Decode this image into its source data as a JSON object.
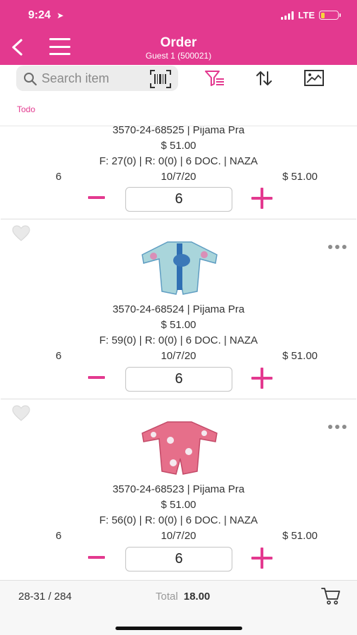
{
  "status_bar": {
    "time": "9:24",
    "network": "LTE",
    "battery_color": "#f7d43b"
  },
  "header": {
    "title": "Order",
    "subtitle": "Guest 1 (500021)",
    "background": "#e3398f"
  },
  "toolbar": {
    "search_placeholder": "Search item",
    "icons": [
      "search-icon",
      "barcode-icon",
      "filter-icon",
      "sort-icon",
      "image-icon"
    ]
  },
  "filter_tag": "Todo",
  "items": [
    {
      "code": "3570-24-68525 | Pijama Pra",
      "price": "$ 51.00",
      "stock": "F: 27(0) | R: 0(0) | 6 DOC. | NAZA",
      "qty_label": "6",
      "date": "10/7/20",
      "total": "$ 51.00",
      "qty": "6"
    },
    {
      "code": "3570-24-68524 | Pijama Pra",
      "price": "$ 51.00",
      "stock": "F: 59(0) | R: 0(0) | 6 DOC. | NAZA",
      "qty_label": "6",
      "date": "10/7/20",
      "total": "$ 51.00",
      "qty": "6",
      "image_color": "#9fd3d8"
    },
    {
      "code": "3570-24-68523 | Pijama Pra",
      "price": "$ 51.00",
      "stock": "F: 56(0) | R: 0(0) | 6 DOC. | NAZA",
      "qty_label": "6",
      "date": "10/7/20",
      "total": "$ 51.00",
      "qty": "6",
      "image_color": "#e66f8a"
    }
  ],
  "footer": {
    "range": "28-31 / 284",
    "total_label": "Total",
    "total_value": "18.00"
  },
  "accent": "#e3398f"
}
